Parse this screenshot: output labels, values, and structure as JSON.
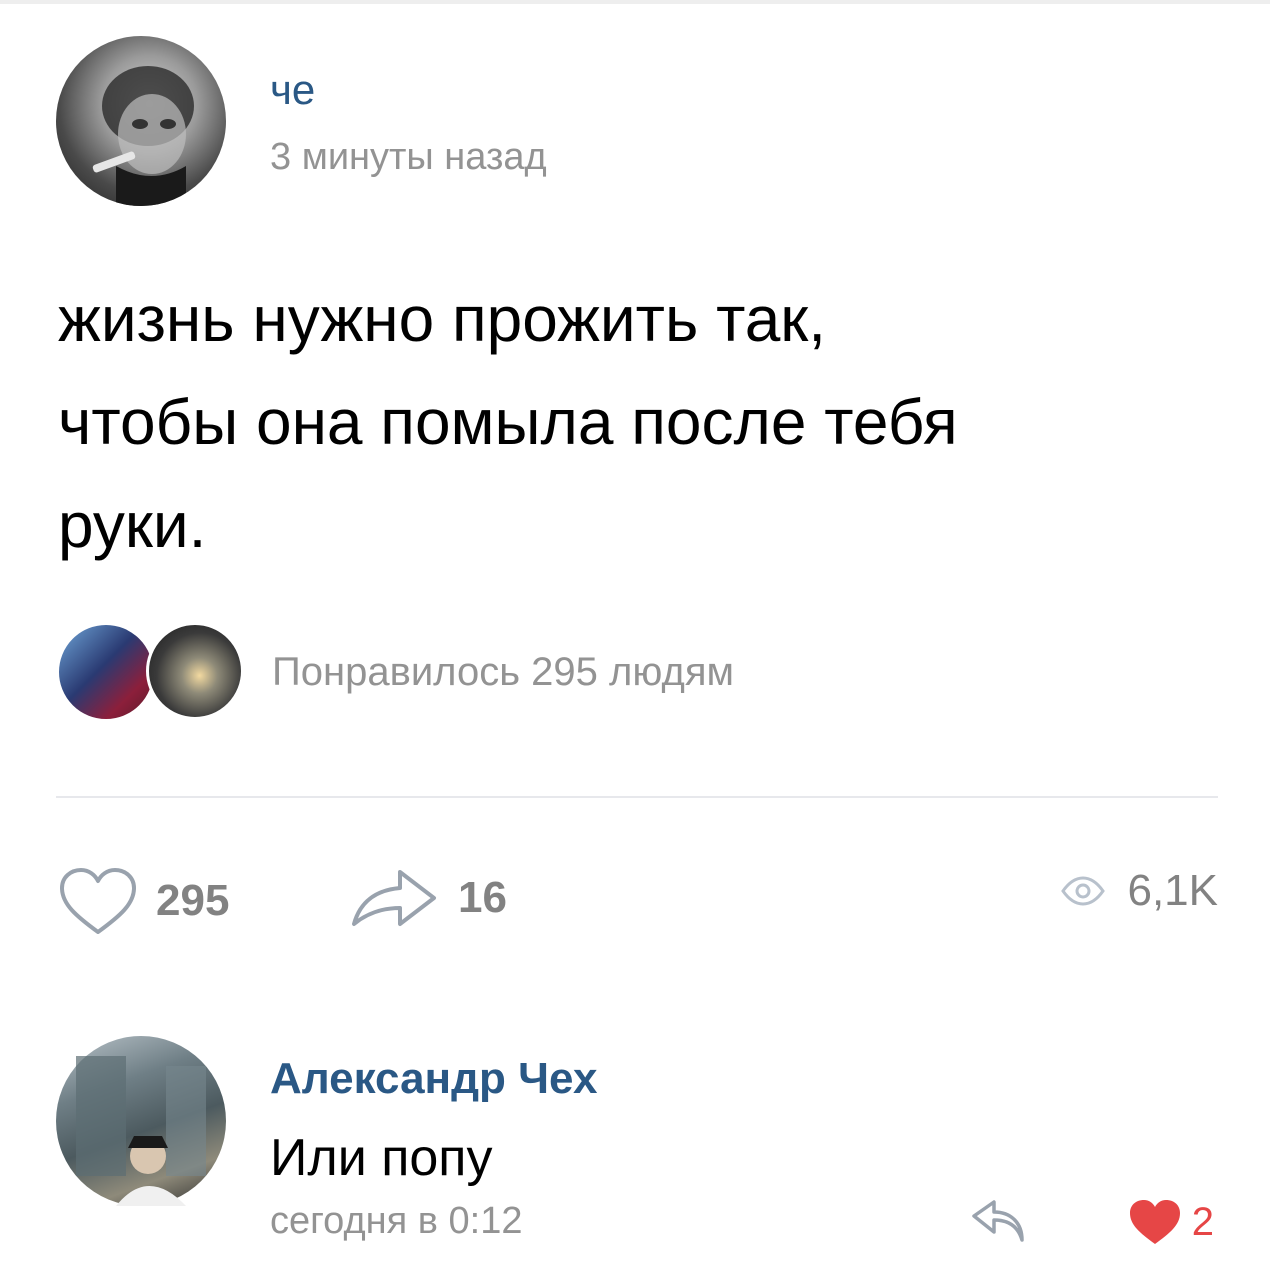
{
  "post": {
    "author": "че",
    "time": "3 минуты назад",
    "text_lines": [
      "жизнь нужно прожить так,",
      "чтобы она помыла после тебя",
      "руки."
    ],
    "avatar_icon": "profile-photo",
    "likes_summary": "Понравилось 295 людям"
  },
  "actions": {
    "likes": "295",
    "shares": "16",
    "views": "6,1K",
    "like_icon": "heart-outline-icon",
    "share_icon": "share-arrow-icon",
    "views_icon": "eye-icon"
  },
  "comment": {
    "author": "Александр Чех",
    "text": "Или попу",
    "time": "сегодня в 0:12",
    "likes": "2",
    "reply_icon": "reply-arrow-icon",
    "like_icon": "heart-filled-icon"
  },
  "colors": {
    "link": "#2a5885",
    "secondary": "#939393",
    "action": "#828282",
    "liked": "#e64646",
    "divider": "#e7e8ec"
  }
}
